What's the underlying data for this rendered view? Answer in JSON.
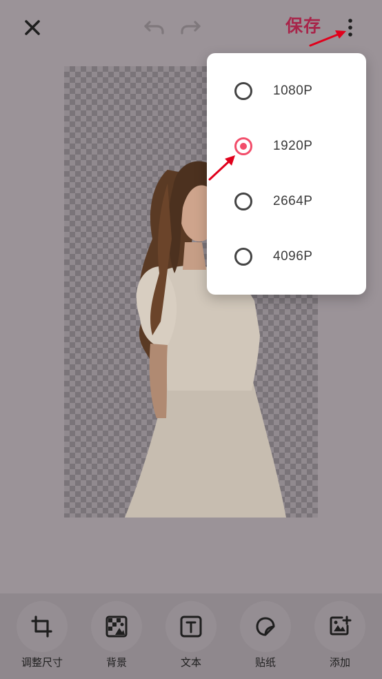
{
  "header": {
    "close_icon": "close-icon",
    "undo_icon": "undo-icon",
    "redo_icon": "redo-icon",
    "save_label": "保存",
    "more_icon": "more-vert-icon"
  },
  "resolution_menu": {
    "options": [
      {
        "label": "1080P",
        "selected": false
      },
      {
        "label": "1920P",
        "selected": true
      },
      {
        "label": "2664P",
        "selected": false
      },
      {
        "label": "4096P",
        "selected": false
      }
    ]
  },
  "colors": {
    "accent": "#f24d6a",
    "save_text": "#a8254a",
    "annotation_arrow": "#e0001b",
    "overlay_bg": "#9b9398"
  },
  "toolbar": {
    "items": [
      {
        "label": "调整尺寸",
        "icon": "crop-icon"
      },
      {
        "label": "背景",
        "icon": "background-icon"
      },
      {
        "label": "文本",
        "icon": "text-icon"
      },
      {
        "label": "贴纸",
        "icon": "sticker-icon"
      },
      {
        "label": "添加",
        "icon": "add-image-icon"
      }
    ]
  }
}
